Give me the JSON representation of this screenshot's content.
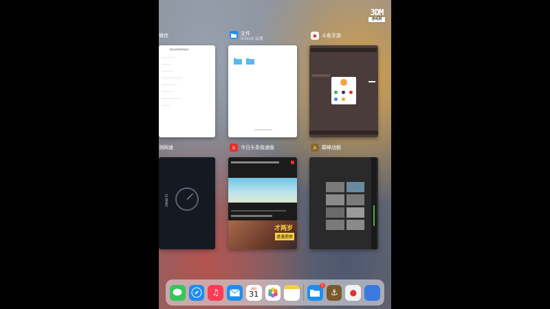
{
  "watermark": {
    "top": "3DM",
    "bottom": "游戏网"
  },
  "cards": {
    "wechat": {
      "title": "微信",
      "content_header": "相关的单纯微商的类"
    },
    "files": {
      "title": "文件",
      "subtitle": "iCloud 云盘"
    },
    "douyu": {
      "title": "斗鱼手游"
    },
    "speedtest": {
      "title": "测网速",
      "reading": "12.00462"
    },
    "toutiao": {
      "title": "今日头条极速版",
      "banner": "才两岁",
      "banner_sub": "遭遇猥亵"
    },
    "battle": {
      "title": "巅峰战舰"
    }
  },
  "dock": {
    "calendar_day_label": "周四",
    "calendar_day": "31",
    "files_badge": "1"
  },
  "colors": {
    "accent_red": "#e0312b",
    "dock_bg": "#ebebf0"
  }
}
